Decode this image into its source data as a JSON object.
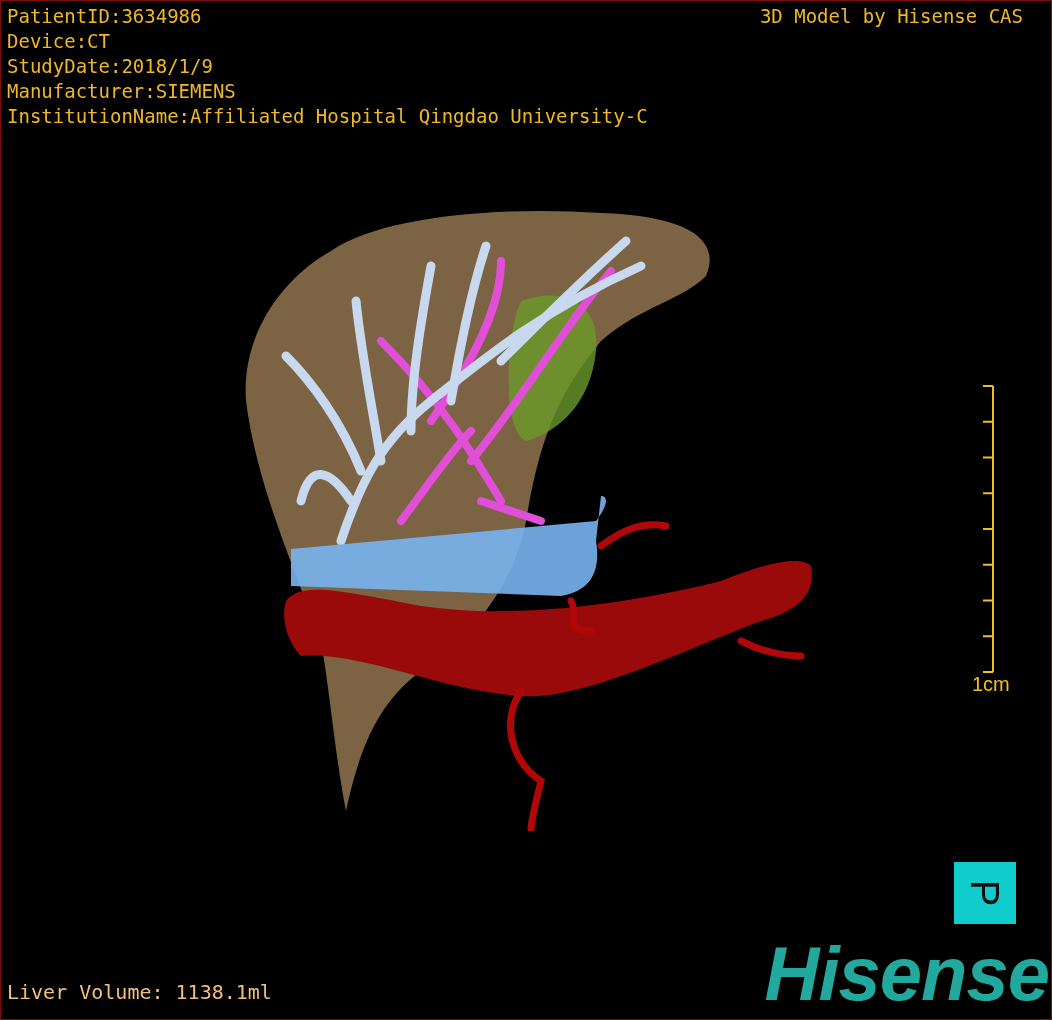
{
  "patient_info": [
    "PatientID:3634986",
    "Device:CT",
    "StudyDate:2018/1/9",
    "Manufacturer:SIEMENS",
    "InstitutionName:Affiliated Hospital Qingdao University-C"
  ],
  "model_credit": "3D Model by Hisense CAS",
  "scale_bar": {
    "label": "1cm"
  },
  "orientation_marker": {
    "label": "P"
  },
  "liver_volume": "Liver Volume: 1138.1ml",
  "logo": "Hisense"
}
